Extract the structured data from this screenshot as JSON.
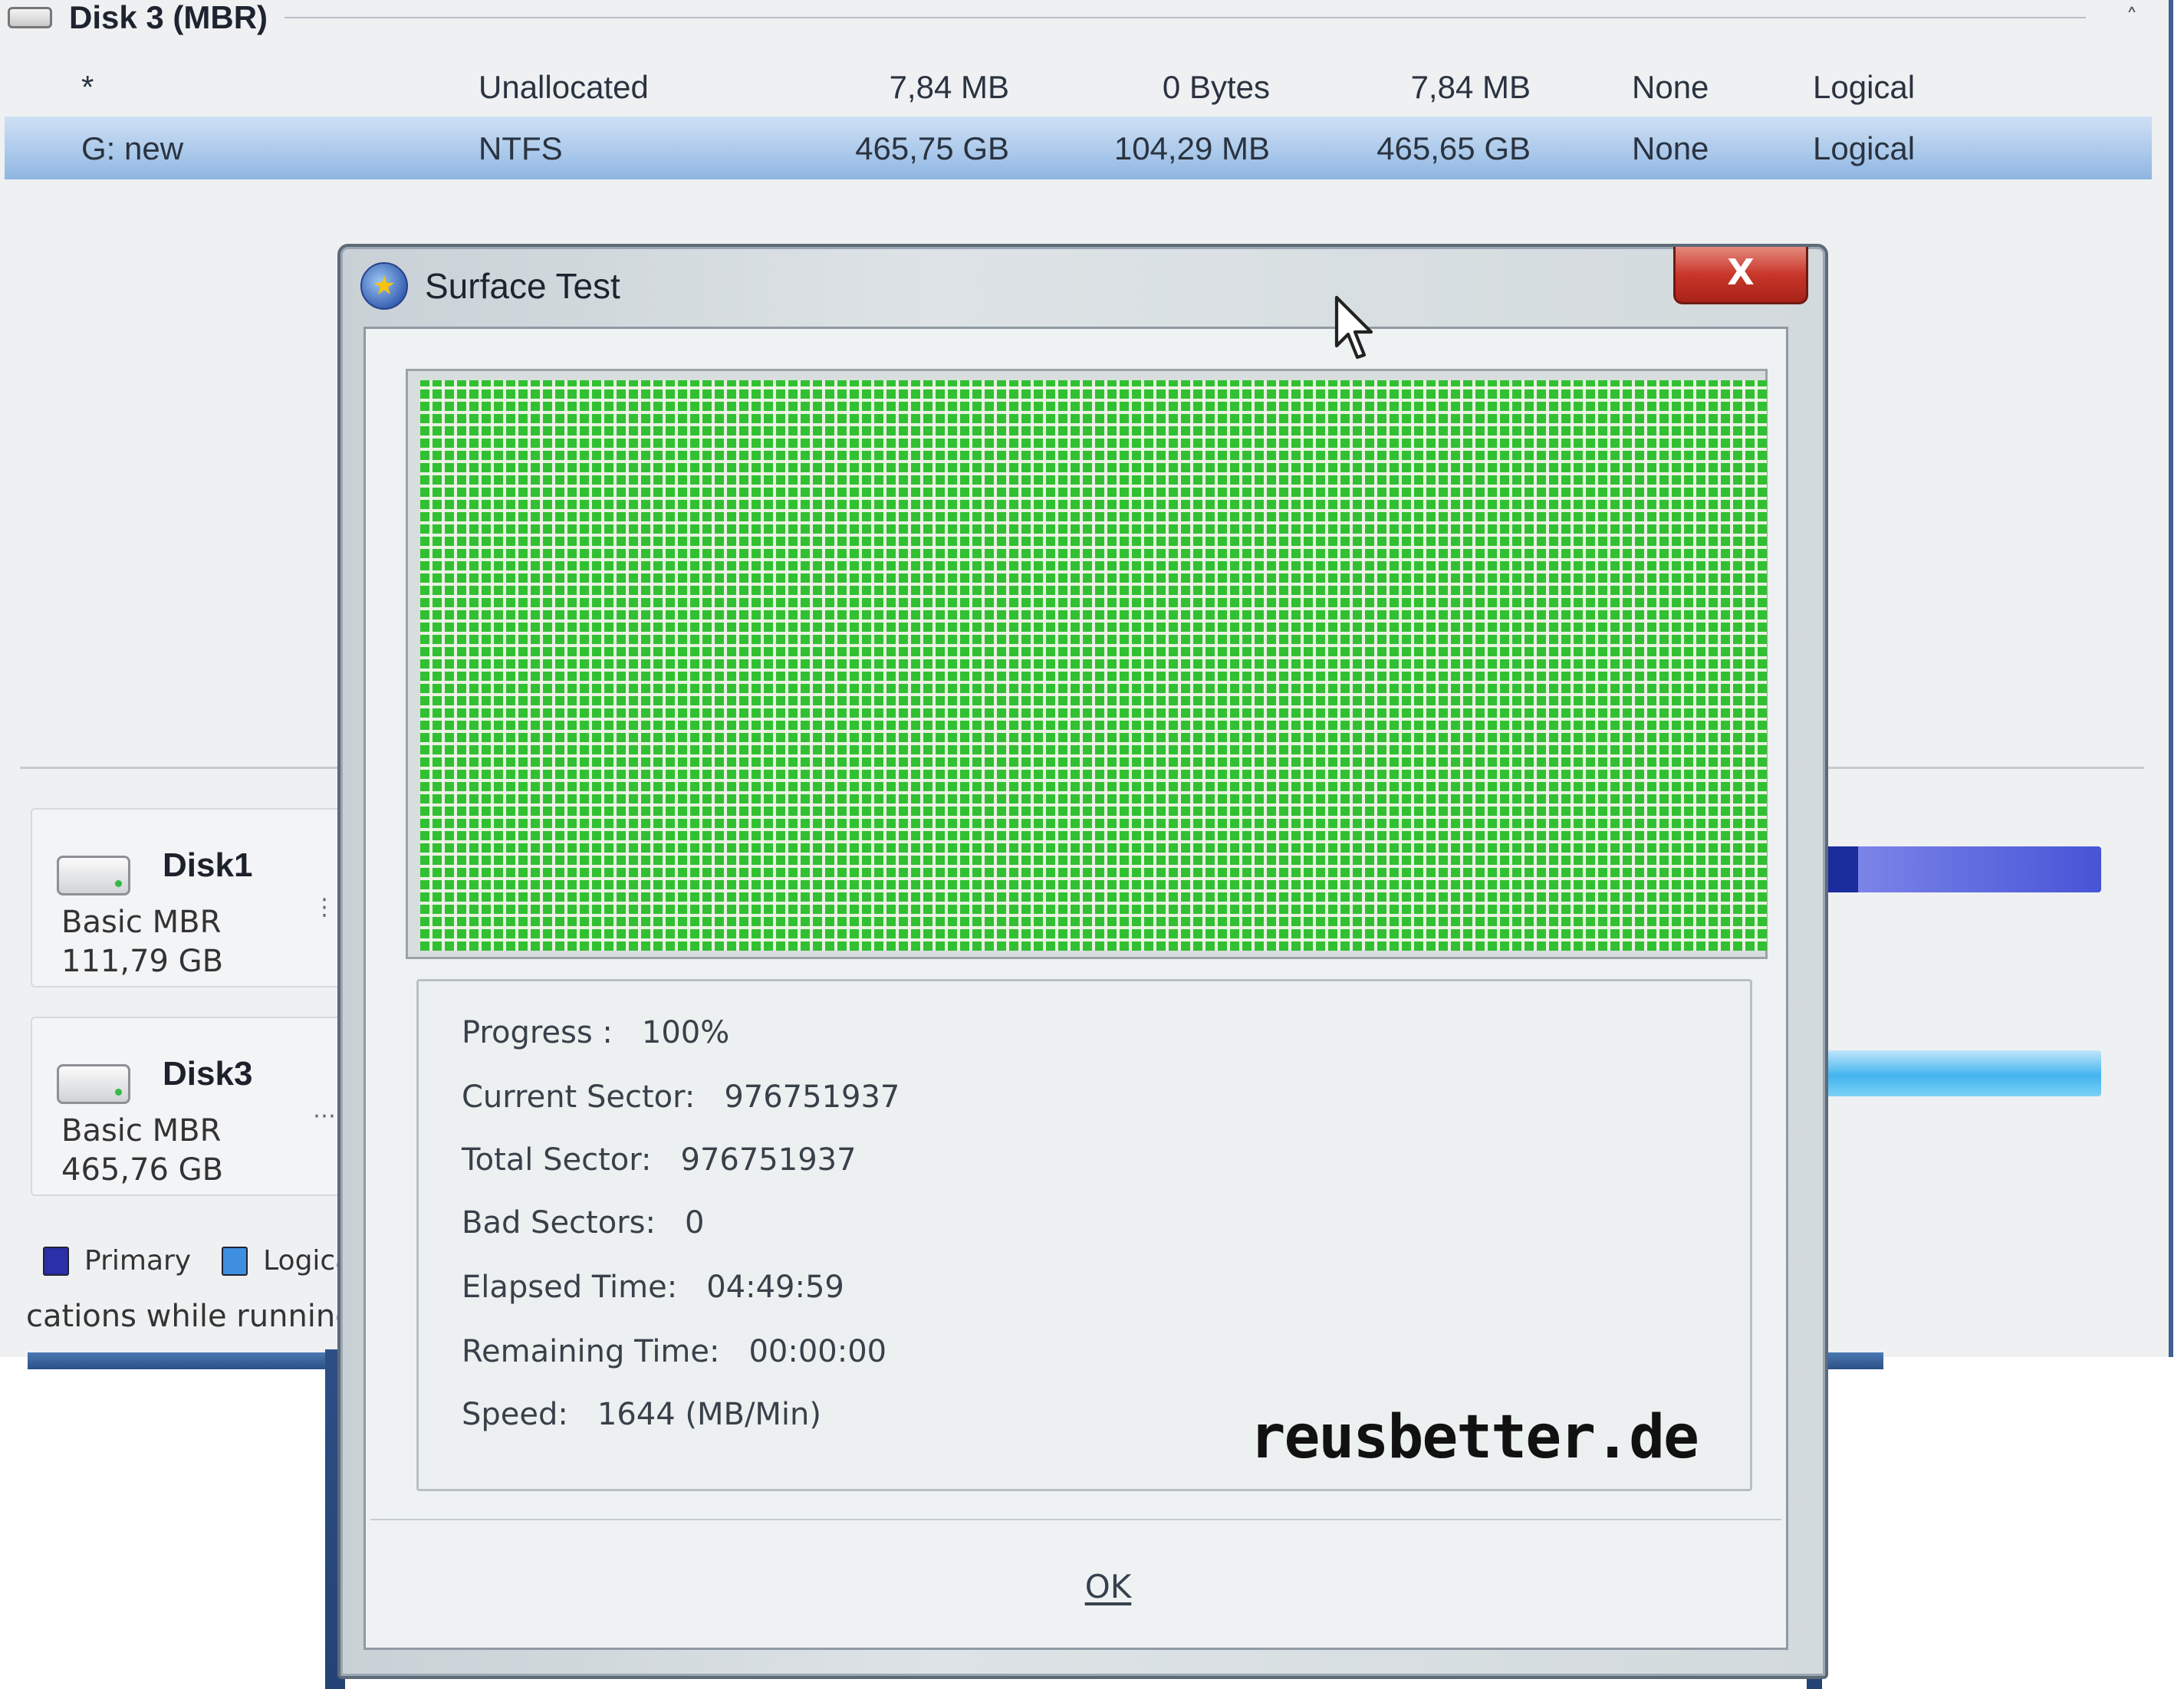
{
  "header": {
    "disk_title": "Disk 3 (MBR)",
    "collapse_glyph": "˄"
  },
  "partitions": [
    {
      "name": "*",
      "fs": "Unallocated",
      "capacity": "7,84 MB",
      "used": "0 Bytes",
      "unused": "7,84 MB",
      "flag": "None",
      "type": "Logical"
    },
    {
      "name": "G: new",
      "fs": "NTFS",
      "capacity": "465,75 GB",
      "used": "104,29 MB",
      "unused": "465,65 GB",
      "flag": "None",
      "type": "Logical"
    }
  ],
  "disks": [
    {
      "name": "Disk1",
      "type": "Basic MBR",
      "size": "111,79 GB"
    },
    {
      "name": "Disk3",
      "type": "Basic MBR",
      "size": "465,76 GB"
    }
  ],
  "legend": {
    "primary": "Primary",
    "logical": "Logica"
  },
  "legend_colors": {
    "primary": "#2b2fa8",
    "logical": "#3f8fe0"
  },
  "status_text": "cations while running Ea",
  "dialog": {
    "title": "Surface Test",
    "close_label": "X",
    "progress_label": "Progress :",
    "progress_value": "100%",
    "current_sector_label": "Current Sector:",
    "current_sector_value": "976751937",
    "total_sector_label": "Total Sector:",
    "total_sector_value": "976751937",
    "bad_sectors_label": "Bad Sectors:",
    "bad_sectors_value": "0",
    "elapsed_label": "Elapsed Time:",
    "elapsed_value": "04:49:59",
    "remaining_label": "Remaining Time:",
    "remaining_value": "00:00:00",
    "speed_label": "Speed:",
    "speed_value": "1644 (MB/Min)",
    "ok_label": "OK",
    "scan_progress": 1.0,
    "scan_block_color": "#31c031"
  },
  "watermark": "reusbetter.de"
}
